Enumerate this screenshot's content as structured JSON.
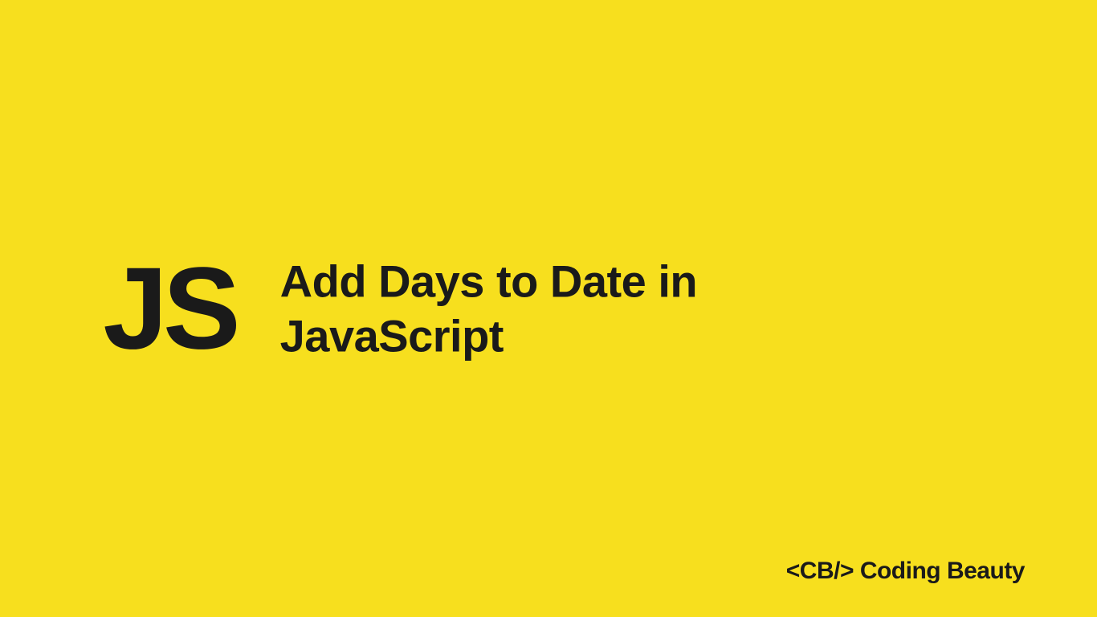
{
  "logo": {
    "text": "JS"
  },
  "title": {
    "line1": "Add Days to Date in",
    "line2": "JavaScript"
  },
  "footer": {
    "text": "<CB/> Coding Beauty"
  },
  "colors": {
    "background": "#f7df1e",
    "text": "#1a1a1a"
  }
}
